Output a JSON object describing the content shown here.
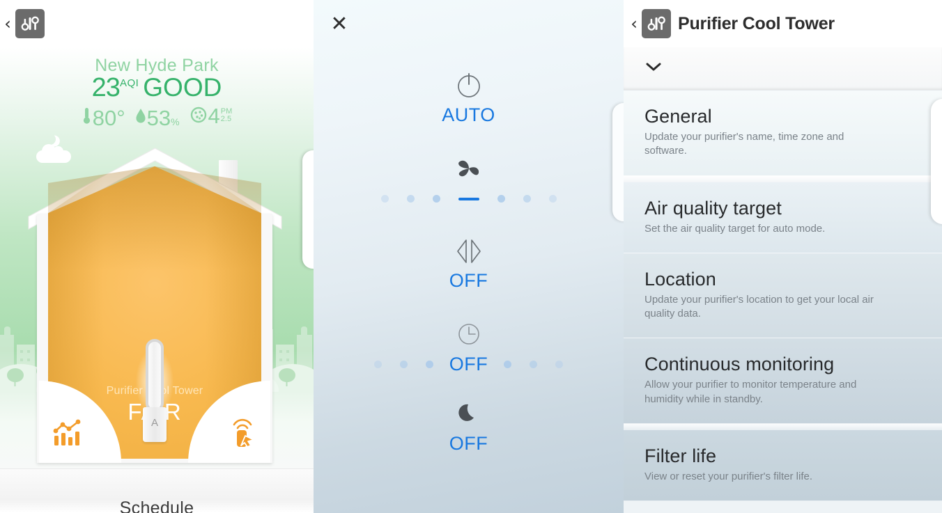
{
  "home": {
    "back_label": "‹",
    "logo_icon": "dyson-logo-icon",
    "city": "New Hyde Park",
    "aqi_value": "23",
    "aqi_unit": "AQI",
    "aqi_word": "GOOD",
    "metrics": [
      {
        "icon": "thermometer-icon",
        "value": "80",
        "unit": "°"
      },
      {
        "icon": "humidity-drop-icon",
        "value": "53",
        "unit": "%"
      },
      {
        "icon": "particle-icon",
        "value": "4",
        "unit_top": "PM",
        "unit_bottom": "2.5"
      }
    ],
    "device_name": "Purifier Cool Tower",
    "device_status": "FAIR",
    "purifier_mode_letter": "A",
    "left_arc_icon": "air-quality-graph-icon",
    "right_arc_icon": "remote-control-icon",
    "footer_label": "Schedule"
  },
  "controls": {
    "close_label": "✕",
    "items": [
      {
        "icon": "power-icon",
        "label": "AUTO",
        "name": "power-mode-control"
      },
      {
        "icon": "fan-speed-icon",
        "label": "",
        "name": "fan-speed-control"
      },
      {
        "icon": "oscillation-icon",
        "label": "OFF",
        "name": "oscillation-control"
      },
      {
        "icon": "timer-clock-icon",
        "label": "OFF",
        "name": "sleep-timer-control"
      },
      {
        "icon": "night-mode-moon-icon",
        "label": "OFF",
        "name": "night-mode-control"
      }
    ],
    "fan_speed_dots": 7,
    "fan_speed_selected_index": 3,
    "timer_dots": 6,
    "accent_color": "#1878e0"
  },
  "settings": {
    "back_label": "‹",
    "logo_icon": "dyson-logo-icon",
    "title": "Purifier Cool Tower",
    "collapse_icon": "chevron-down-icon",
    "items": [
      {
        "title": "General",
        "subtitle": "Update your purifier's name, time zone and software."
      },
      {
        "title": "Air quality target",
        "subtitle": "Set the air quality target for auto mode."
      },
      {
        "title": "Location",
        "subtitle": "Update your purifier's location to get your local air quality data."
      },
      {
        "title": "Continuous monitoring",
        "subtitle": "Allow your purifier to monitor temperature and humidity while in standby."
      },
      {
        "title": "Filter life",
        "subtitle": "View or reset your purifier's filter life."
      }
    ]
  },
  "colors": {
    "aqi_good": "#35b26a",
    "aqi_pale": "#8fd3a2",
    "house_orange": "#f8b94f",
    "accent_blue": "#1878e0",
    "arc_icon_orange": "#f39c2a"
  }
}
